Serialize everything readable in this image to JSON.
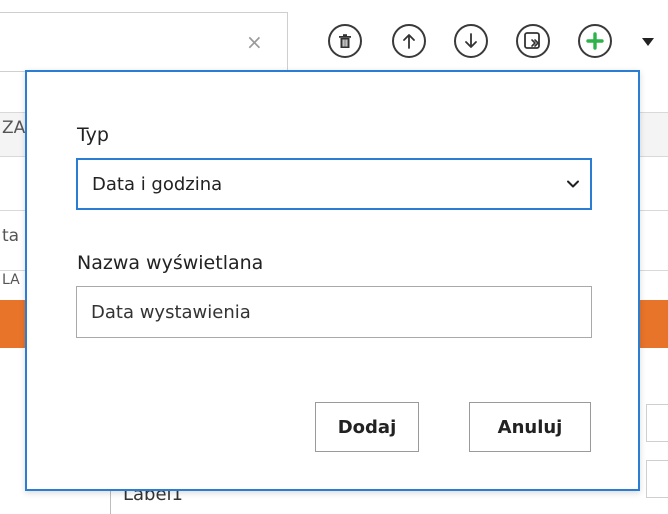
{
  "background": {
    "search_clear": "×",
    "fragment_1": "ZA",
    "fragment_2": "ta",
    "fragment_3": "LA",
    "label_row": "Label1"
  },
  "toolbar": {
    "icons": [
      "trash-icon",
      "arrow-up-icon",
      "arrow-down-icon",
      "export-icon",
      "plus-icon",
      "caret-down-icon"
    ],
    "add_color": "#2db34a"
  },
  "dialog": {
    "type_label": "Typ",
    "type_selected": "Data i godzina",
    "display_name_label": "Nazwa wyświetlana",
    "display_name_value": "Data wystawienia",
    "add_button": "Dodaj",
    "cancel_button": "Anuluj",
    "accent_color": "#2b7cd3"
  }
}
